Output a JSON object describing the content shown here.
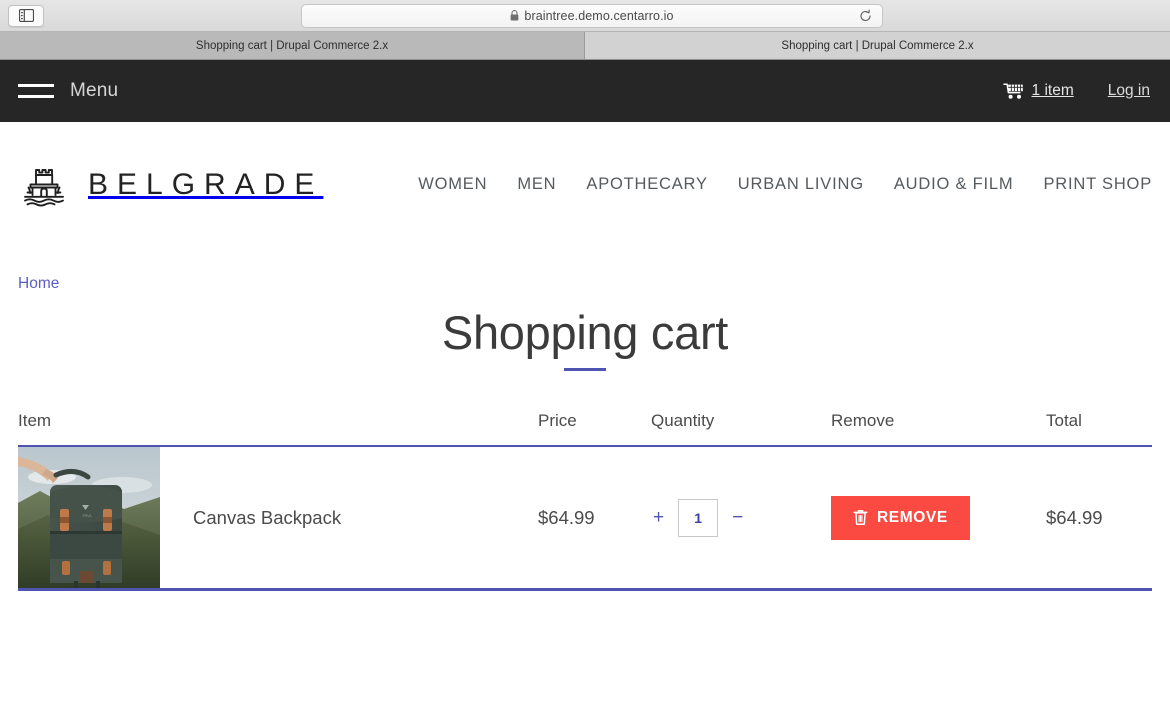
{
  "browser": {
    "sidebar_toggle_name": "sidebar-toggle-icon",
    "url": "braintree.demo.centarro.io",
    "lock_icon": "lock-icon",
    "reload_icon": "reload-icon",
    "tabs": [
      {
        "title": "Shopping cart | Drupal Commerce 2.x",
        "active": false
      },
      {
        "title": "Shopping cart | Drupal Commerce 2.x",
        "active": true
      }
    ]
  },
  "topbar": {
    "menu_label": "Menu",
    "cart_label": "1 item",
    "cart_icon": "shopping-cart-icon",
    "login_label": "Log in"
  },
  "site_header": {
    "logo_text": "BELGRADE",
    "logo_icon": "fortress-logo-icon",
    "nav": [
      {
        "label": "WOMEN"
      },
      {
        "label": "MEN"
      },
      {
        "label": "APOTHECARY"
      },
      {
        "label": "URBAN LIVING"
      },
      {
        "label": "AUDIO & FILM"
      },
      {
        "label": "PRINT SHOP"
      }
    ]
  },
  "breadcrumb": {
    "home_label": "Home"
  },
  "page": {
    "title": "Shopping cart"
  },
  "cart": {
    "headers": {
      "item": "Item",
      "price": "Price",
      "quantity": "Quantity",
      "remove": "Remove",
      "total": "Total"
    },
    "rows": [
      {
        "product_name": "Canvas Backpack",
        "price": "$64.99",
        "quantity": "1",
        "increment_label": "+",
        "decrement_label": "−",
        "remove_label": "REMOVE",
        "remove_icon": "trash-icon",
        "total": "$64.99",
        "thumbnail_alt": "canvas-backpack-photo"
      }
    ]
  },
  "colors": {
    "accent_purple": "#4f54b2",
    "link_purple": "#5b5fc0",
    "danger_red": "#fa4a42",
    "topbar_dark": "#262626"
  }
}
